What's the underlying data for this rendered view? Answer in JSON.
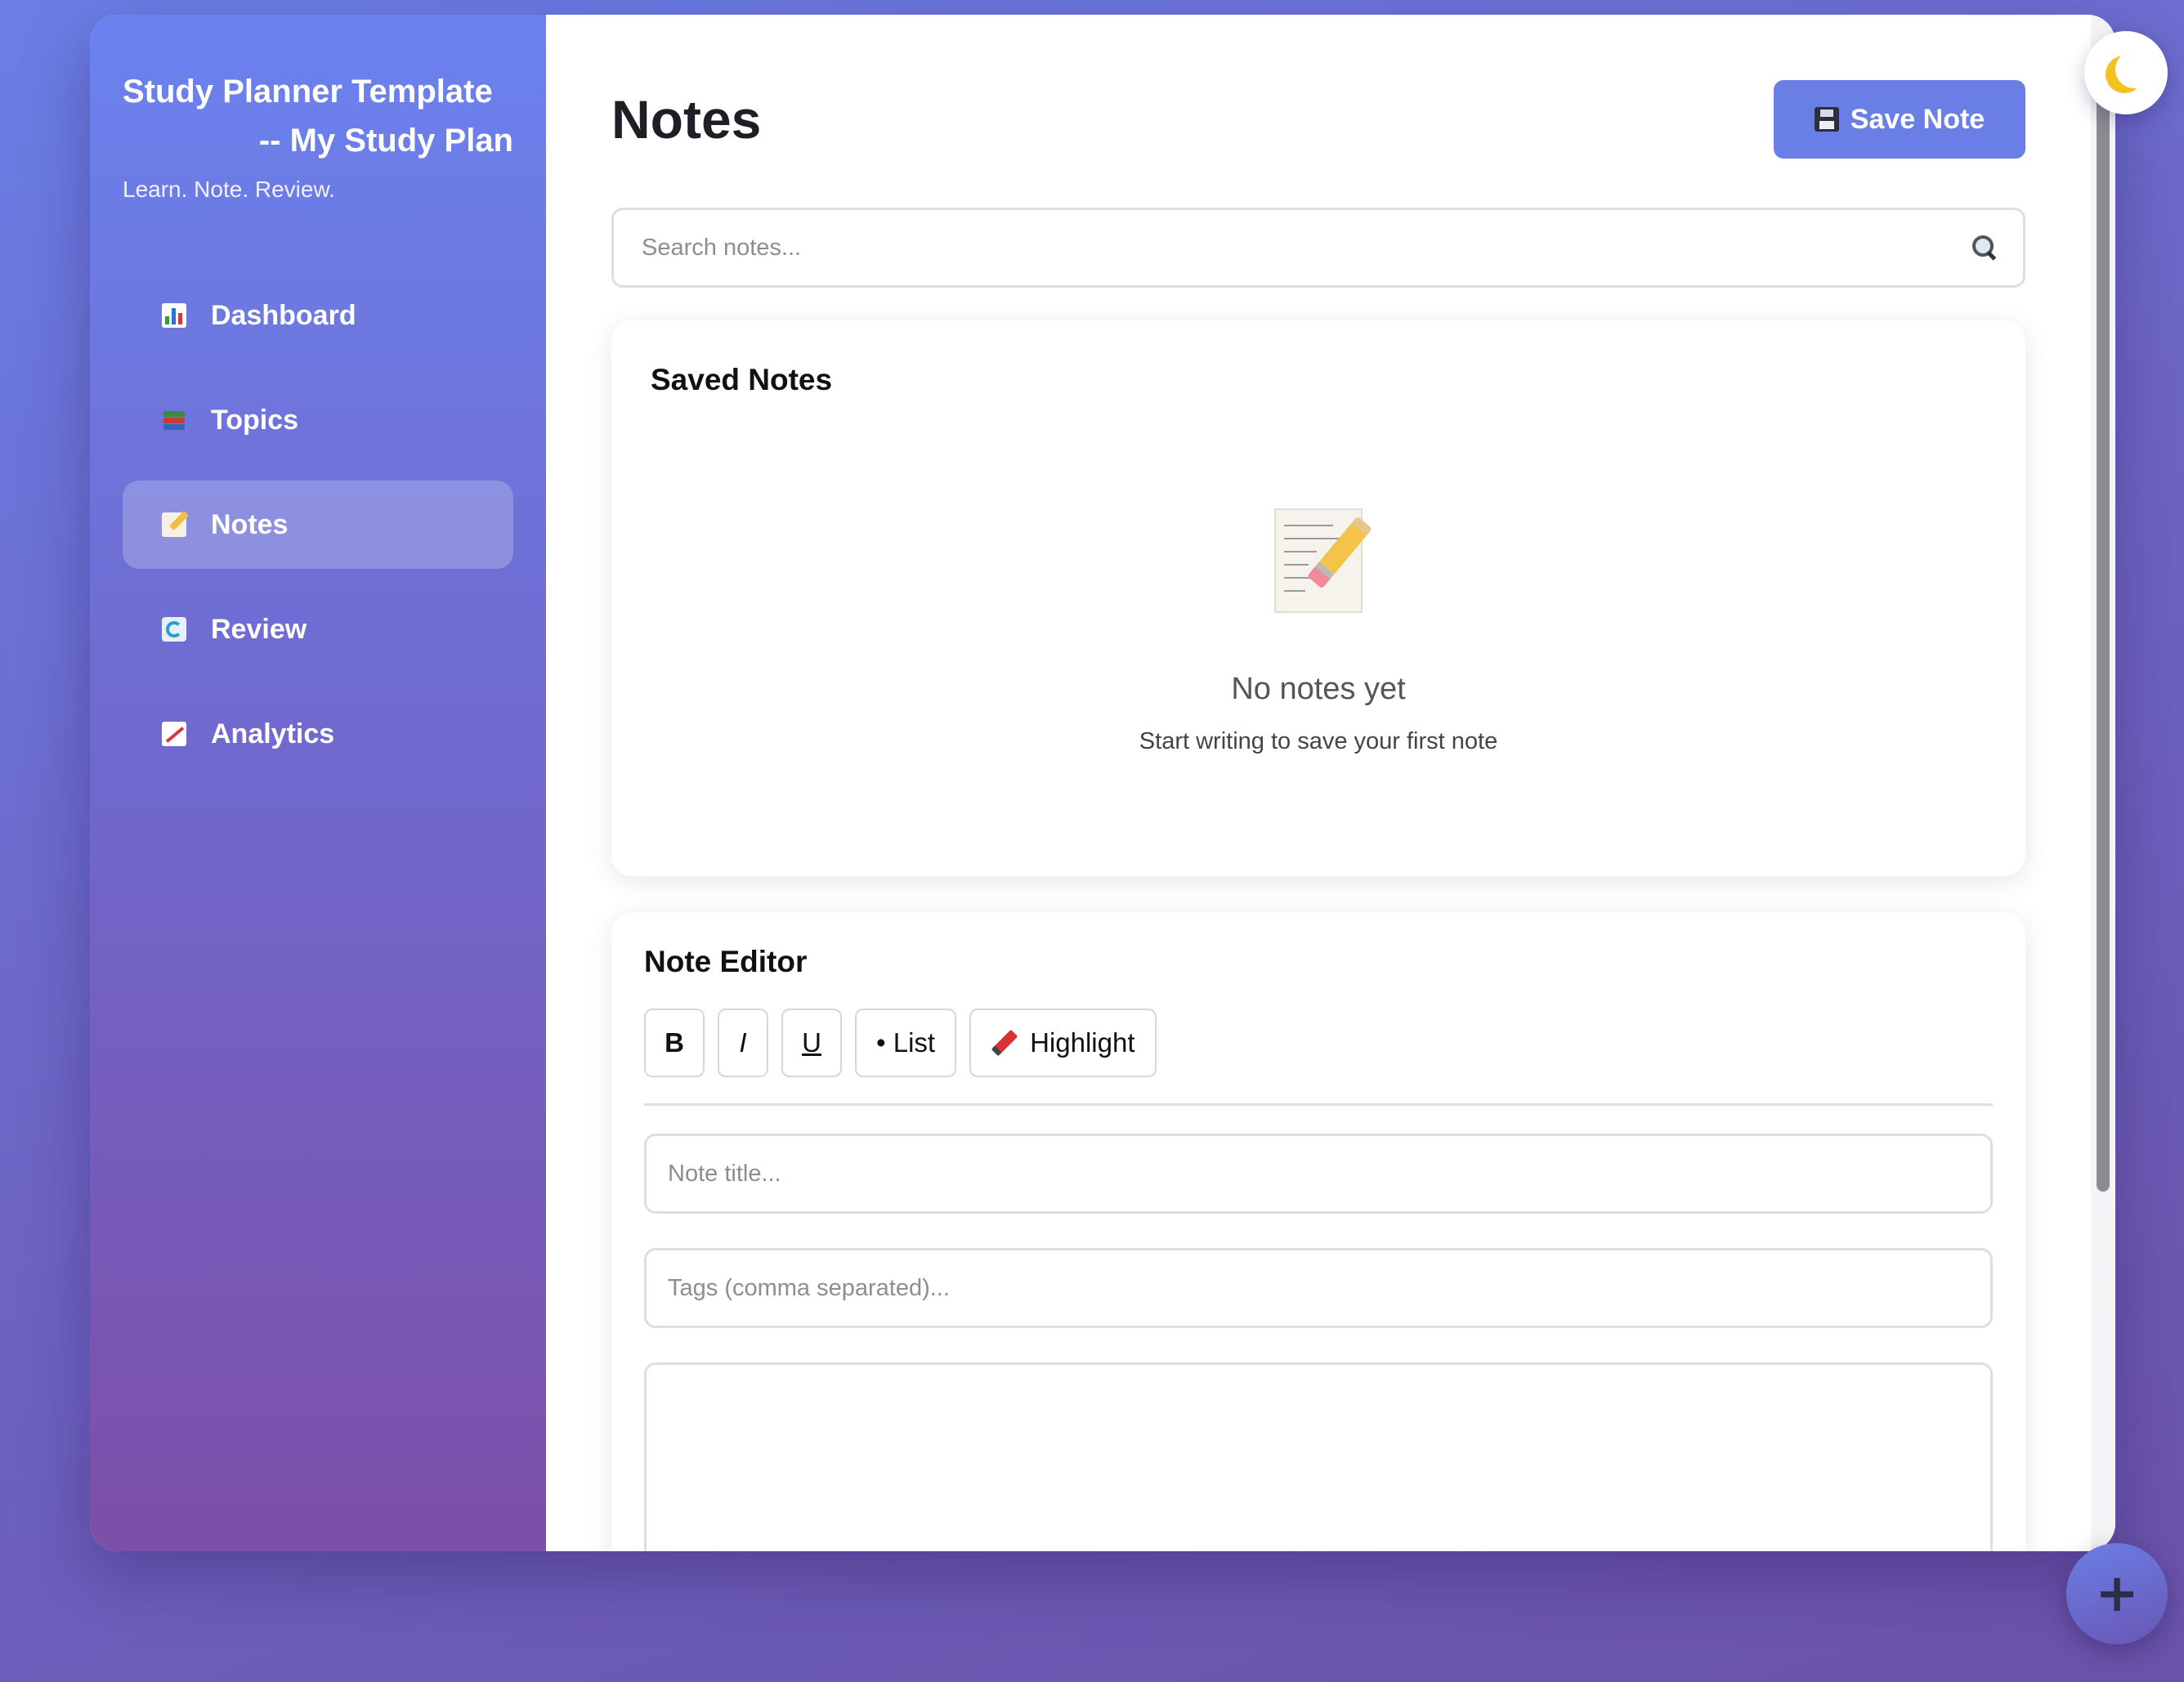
{
  "sidebar": {
    "title_line1": "Study Planner Template",
    "title_line2": "-- My Study Plan",
    "tagline": "Learn. Note. Review.",
    "items": [
      {
        "label": "Dashboard",
        "icon": "bar-chart-icon"
      },
      {
        "label": "Topics",
        "icon": "books-icon"
      },
      {
        "label": "Notes",
        "icon": "memo-icon",
        "active": true
      },
      {
        "label": "Review",
        "icon": "refresh-icon"
      },
      {
        "label": "Analytics",
        "icon": "chart-increasing-icon"
      }
    ]
  },
  "header": {
    "title": "Notes",
    "save_label": "Save Note"
  },
  "search": {
    "placeholder": "Search notes..."
  },
  "saved_notes": {
    "title": "Saved Notes",
    "empty_title": "No notes yet",
    "empty_sub": "Start writing to save your first note"
  },
  "editor": {
    "title": "Note Editor",
    "toolbar": {
      "bold": "B",
      "italic": "I",
      "underline": "U",
      "list": "• List",
      "highlight": "Highlight"
    },
    "title_placeholder": "Note title...",
    "tags_placeholder": "Tags (comma separated)..."
  },
  "fab_label": "+",
  "colors": {
    "accent": "#6a7fe6",
    "sidebar_top": "#6b82ee",
    "sidebar_bottom": "#7c4fa8"
  }
}
